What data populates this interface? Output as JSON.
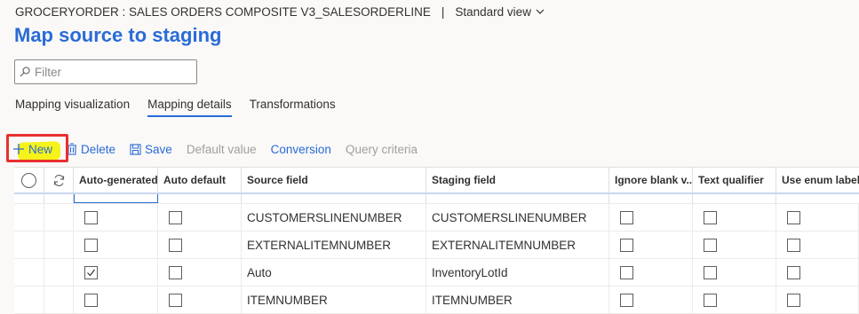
{
  "header": {
    "breadcrumb": "GROCERYORDER : SALES ORDERS COMPOSITE V3_SALESORDERLINE",
    "separator": "|",
    "view_label": "Standard view"
  },
  "page": {
    "title": "Map source to staging"
  },
  "filter": {
    "placeholder": "Filter",
    "value": ""
  },
  "tabs": [
    {
      "label": "Mapping visualization",
      "active": false
    },
    {
      "label": "Mapping details",
      "active": true
    },
    {
      "label": "Transformations",
      "active": false
    }
  ],
  "toolbar": {
    "new_label": "New",
    "delete_label": "Delete",
    "save_label": "Save",
    "default_value_label": "Default value",
    "conversion_label": "Conversion",
    "query_criteria_label": "Query criteria"
  },
  "grid": {
    "columns": [
      "Auto-generated",
      "Auto default",
      "Source field",
      "Staging field",
      "Ignore blank v...",
      "Text qualifier",
      "Use enum label"
    ],
    "rows": [
      {
        "auto_generated": false,
        "auto_default": false,
        "source": "CUSTOMERSLINENUMBER",
        "staging": "CUSTOMERSLINENUMBER",
        "ignore_blank": false,
        "text_qualifier": false,
        "use_enum_label": false
      },
      {
        "auto_generated": false,
        "auto_default": false,
        "source": "EXTERNALITEMNUMBER",
        "staging": "EXTERNALITEMNUMBER",
        "ignore_blank": false,
        "text_qualifier": false,
        "use_enum_label": false
      },
      {
        "auto_generated": true,
        "auto_default": false,
        "source": "Auto",
        "staging": "InventoryLotId",
        "ignore_blank": false,
        "text_qualifier": false,
        "use_enum_label": false
      },
      {
        "auto_generated": false,
        "auto_default": false,
        "source": "ITEMNUMBER",
        "staging": "ITEMNUMBER",
        "ignore_blank": false,
        "text_qualifier": false,
        "use_enum_label": false
      }
    ]
  },
  "colors": {
    "accent": "#2a6bd6",
    "highlight": "#f6f31a",
    "annotation_box": "#e8302f",
    "disabled_text": "#a19f9d"
  }
}
